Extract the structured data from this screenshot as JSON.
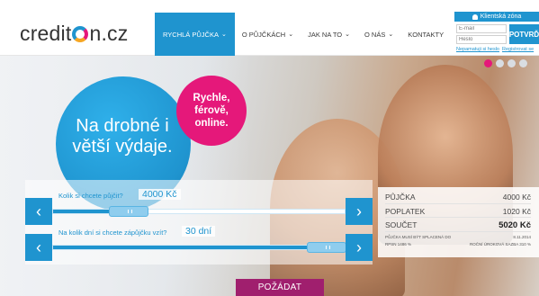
{
  "brand": {
    "logo_prefix": "credit",
    "logo_suffix": "n.cz"
  },
  "nav": {
    "items": [
      {
        "label": "RYCHLÁ PŮJČKA",
        "active": true
      },
      {
        "label": "O PŮJČKÁCH",
        "active": false
      },
      {
        "label": "JAK NA TO",
        "active": false
      },
      {
        "label": "O NÁS",
        "active": false
      },
      {
        "label": "KONTAKTY",
        "active": false
      }
    ],
    "chevron": "⌄"
  },
  "client_zone": {
    "title": "Klientská zóna",
    "email_placeholder": "E-mail",
    "password_placeholder": "Heslo",
    "submit_label": "POTVRĎ",
    "forgot_link": "Nepamatuji si heslo",
    "register_link": "Registrovat se"
  },
  "hero": {
    "headline": "Na drobné i větší výdaje.",
    "badge": "Rychle, férově, online.",
    "slides": {
      "count": 4,
      "active_index": 0
    }
  },
  "calculator": {
    "amount_question": "Kolik si chcete půjčit?",
    "amount_value": "4000 Kč",
    "amount_fraction": 0.22,
    "days_question": "Na kolik dní si chcete zápůjčku vzít?",
    "days_value": "30 dní",
    "days_fraction": 1.0,
    "prev_symbol": "‹",
    "next_symbol": "›"
  },
  "summary": {
    "rows": [
      {
        "label": "PŮJČKA",
        "value": "4000 Kč"
      },
      {
        "label": "POPLATEK",
        "value": "1020 Kč"
      },
      {
        "label": "SOUČET",
        "value": "5020 Kč"
      }
    ],
    "due_label": "PŮJČKA MUSÍ BÝT SPLACENÁ DO",
    "due_value": "8.11.2014",
    "rpsn_label": "RPSN",
    "rpsn_value": "1486 %",
    "rate_label": "ROČNÍ ÚROKOVÁ SAZBA",
    "rate_value": "310 %"
  },
  "cta": {
    "label": "POŽÁDAT"
  },
  "colors": {
    "blue": "#1f94cf",
    "pink": "#e5187a",
    "purple": "#a01f6e"
  }
}
